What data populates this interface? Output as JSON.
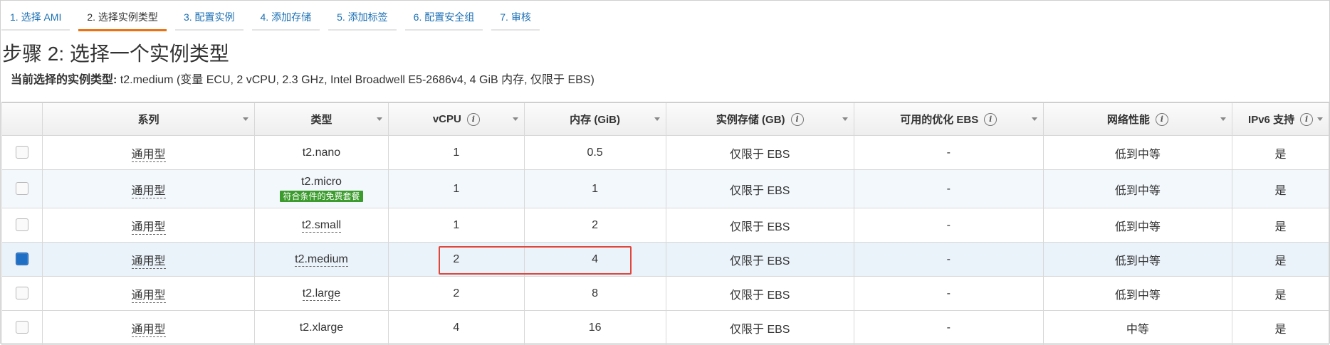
{
  "steps": [
    {
      "label": "1. 选择 AMI",
      "active": false
    },
    {
      "label": "2. 选择实例类型",
      "active": true
    },
    {
      "label": "3. 配置实例",
      "active": false
    },
    {
      "label": "4. 添加存储",
      "active": false
    },
    {
      "label": "5. 添加标签",
      "active": false
    },
    {
      "label": "6. 配置安全组",
      "active": false
    },
    {
      "label": "7. 审核",
      "active": false
    }
  ],
  "page_title": "步骤 2: 选择一个实例类型",
  "current_selection": {
    "label": "当前选择的实例类型:",
    "value": "t2.medium (变量 ECU, 2 vCPU, 2.3 GHz, Intel Broadwell E5-2686v4, 4 GiB 内存, 仅限于 EBS)"
  },
  "table": {
    "columns": [
      "系列",
      "类型",
      "vCPU",
      "内存 (GiB)",
      "实例存储 (GB)",
      "可用的优化 EBS",
      "网络性能",
      "IPv6 支持"
    ],
    "free_tier_badge": "符合条件的免费套餐",
    "rows": [
      {
        "family": "通用型",
        "type": "t2.nano",
        "vcpu": "1",
        "memory": "0.5",
        "storage": "仅限于 EBS",
        "ebs": "-",
        "network": "低到中等",
        "ipv6": "是",
        "checked": false
      },
      {
        "family": "通用型",
        "type": "t2.micro",
        "vcpu": "1",
        "memory": "1",
        "storage": "仅限于 EBS",
        "ebs": "-",
        "network": "低到中等",
        "ipv6": "是",
        "checked": false
      },
      {
        "family": "通用型",
        "type": "t2.small",
        "vcpu": "1",
        "memory": "2",
        "storage": "仅限于 EBS",
        "ebs": "-",
        "network": "低到中等",
        "ipv6": "是",
        "checked": false
      },
      {
        "family": "通用型",
        "type": "t2.medium",
        "vcpu": "2",
        "memory": "4",
        "storage": "仅限于 EBS",
        "ebs": "-",
        "network": "低到中等",
        "ipv6": "是",
        "checked": true
      },
      {
        "family": "通用型",
        "type": "t2.large",
        "vcpu": "2",
        "memory": "8",
        "storage": "仅限于 EBS",
        "ebs": "-",
        "network": "低到中等",
        "ipv6": "是",
        "checked": false
      },
      {
        "family": "通用型",
        "type": "t2.xlarge",
        "vcpu": "4",
        "memory": "16",
        "storage": "仅限于 EBS",
        "ebs": "-",
        "network": "中等",
        "ipv6": "是",
        "checked": false
      }
    ]
  },
  "colors": {
    "accent": "#ec7211",
    "link": "#1a6fb4",
    "checked": "#1f6fc5",
    "highlight": "#e0463a",
    "badge": "#3b9c2d"
  },
  "icons": {
    "info": "info-icon",
    "sort": "sort-down-icon"
  }
}
